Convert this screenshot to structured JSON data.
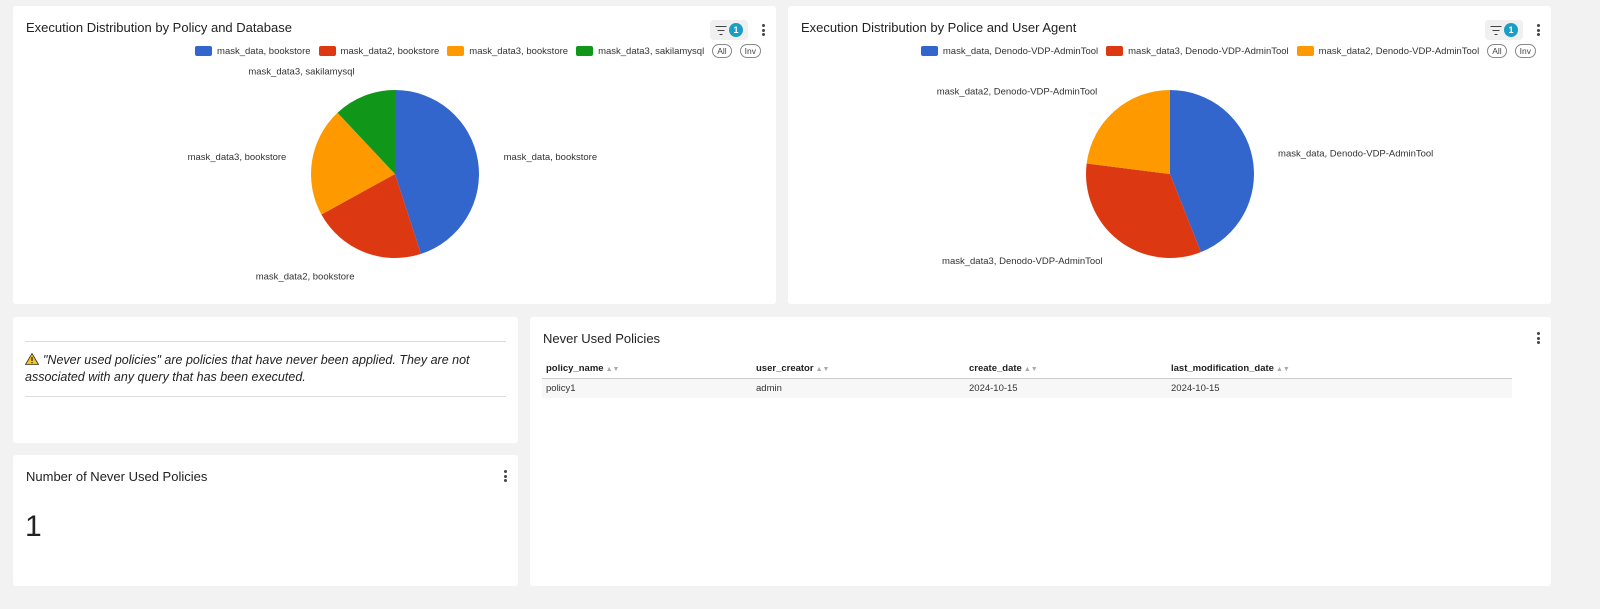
{
  "policy_db_chart": {
    "title": "Execution Distribution by Policy and Database",
    "filter_count": "1",
    "legend_all": "All",
    "legend_inv": "Inv",
    "chart_data": {
      "type": "pie",
      "labels": [
        "mask_data, bookstore",
        "mask_data2, bookstore",
        "mask_data3, bookstore",
        "mask_data3, sakilamysql"
      ],
      "values": [
        45,
        22,
        21,
        12
      ],
      "colors": [
        "#3366cc",
        "#dc3912",
        "#ff9900",
        "#109618"
      ]
    }
  },
  "policy_agent_chart": {
    "title": "Execution Distribution by Police and User Agent",
    "filter_count": "1",
    "legend_all": "All",
    "legend_inv": "Inv",
    "chart_data": {
      "type": "pie",
      "labels": [
        "mask_data, Denodo-VDP-AdminTool",
        "mask_data3, Denodo-VDP-AdminTool",
        "mask_data2, Denodo-VDP-AdminTool"
      ],
      "values": [
        44,
        33,
        23
      ],
      "colors": [
        "#3366cc",
        "#dc3912",
        "#ff9900"
      ]
    }
  },
  "note": {
    "text": "\"Never used policies\" are policies that have never been applied. They are not associated with any query that has been executed."
  },
  "count_card": {
    "title": "Number of Never Used Policies",
    "value": "1"
  },
  "never_used": {
    "title": "Never Used Policies",
    "columns": [
      "policy_name",
      "user_creator",
      "create_date",
      "last_modification_date"
    ],
    "rows": [
      [
        "policy1",
        "admin",
        "2024-10-15",
        "2024-10-15"
      ]
    ]
  }
}
